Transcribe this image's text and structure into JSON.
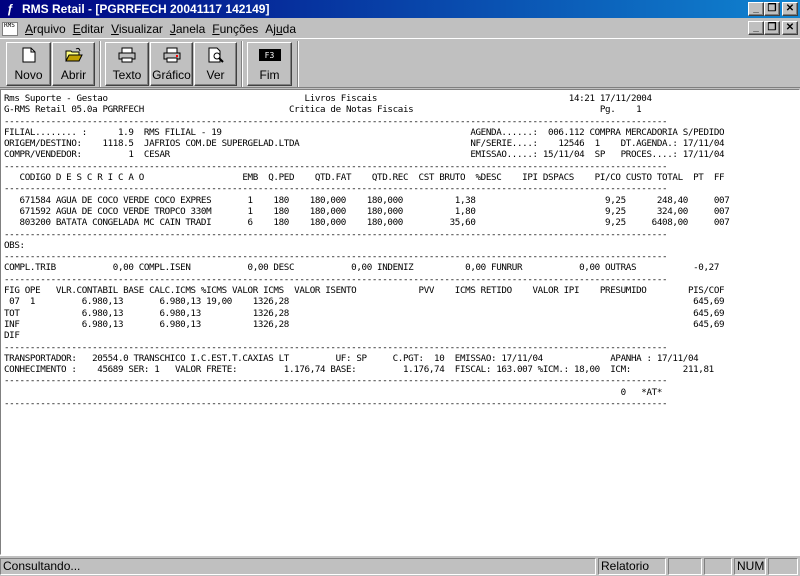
{
  "window": {
    "app_icon": "ƒ",
    "title": "RMS Retail - [PGRRFECH 20041117 142149]"
  },
  "menu": {
    "mdi_icon_text": "RMS",
    "items": [
      {
        "label": "Arquivo",
        "accel": "A",
        "rest": "rquivo"
      },
      {
        "label": "Editar",
        "accel": "E",
        "rest": "ditar"
      },
      {
        "label": "Visualizar",
        "accel": "V",
        "rest": "isualizar"
      },
      {
        "label": "Janela",
        "accel": "J",
        "rest": "anela"
      },
      {
        "label": "Funções",
        "accel": "F",
        "rest": "unções"
      },
      {
        "label": "Ajuda",
        "accel": "u",
        "pre": "Aj",
        "rest": "da"
      }
    ]
  },
  "toolbar": {
    "novo": "Novo",
    "abrir": "Abrir",
    "texto": "Texto",
    "grafico": "Gráfico",
    "ver": "Ver",
    "fim": "Fim",
    "f3_key": "F3"
  },
  "report": {
    "lines": [
      "Rms Suporte - Gestao                                      Livros Fiscais                                     14:21 17/11/2004",
      "G-RMS Retail 05.0a PGRRFECH                            Critica de Notas Fiscais                                    Pg.    1",
      "--------------------------------------------------------------------------------------------------------------------------------",
      "FILIAL........ :      1.9  RMS FILIAL - 19                                                AGENDA......:  006.112 COMPRA MERCADORIA S/PEDIDO",
      "ORIGEM/DESTINO:    1118.5  JAFRIOS COM.DE SUPERGELAD.LTDA                                 NF/SERIE....:    12546  1    DT.AGENDA.: 17/11/04",
      "COMPR/VENDEDOR:         1  CESAR                                                          EMISSAO.....: 15/11/04  SP   PROCES....: 17/11/04",
      "--------------------------------------------------------------------------------------------------------------------------------",
      "   CODIGO D E S C R I C A O                   EMB  Q.PED    QTD.FAT    QTD.REC  CST BRUTO  %DESC    IPI DSPACS    PI/CO CUSTO TOTAL  PT  FF",
      "--------------------------------------------------------------------------------------------------------------------------------",
      "   671584 AGUA DE COCO VERDE COCO EXPRES       1    180    180,000    180,000          1,38                         9,25      248,40     007",
      "   671592 AGUA DE COCO VERDE TROPCO 330M       1    180    180,000    180,000          1,80                         9,25      324,00     007",
      "   803200 BATATA CONGELADA MC CAIN TRADI       6    180    180,000    180,000         35,60                         9,25     6408,00     007",
      "--------------------------------------------------------------------------------------------------------------------------------",
      "OBS:",
      "--------------------------------------------------------------------------------------------------------------------------------",
      "COMPL.TRIB           0,00 COMPL.ISEN           0,00 DESC           0,00 INDENIZ          0,00 FUNRUR           0,00 OUTRAS           -0,27",
      "--------------------------------------------------------------------------------------------------------------------------------",
      "FIG OPE   VLR.CONTABIL BASE CALC.ICMS %ICMS VALOR ICMS  VALOR ISENTO            PVV    ICMS RETIDO    VALOR IPI    PRESUMIDO        PIS/COF",
      " 07  1         6.980,13       6.980,13 19,00    1326,28                                                                              645,69",
      "TOT            6.980,13       6.980,13          1326,28                                                                              645,69",
      "INF            6.980,13       6.980,13          1326,28                                                                              645,69",
      "DIF",
      "--------------------------------------------------------------------------------------------------------------------------------",
      "TRANSPORTADOR:   20554.0 TRANSCHICO I.C.EST.T.CAXIAS LT         UF: SP     C.PGT:  10  EMISSAO: 17/11/04             APANHA : 17/11/04",
      "CONHECIMENTO :    45689 SER: 1   VALOR FRETE:         1.176,74 BASE:         1.176,74  FISCAL: 163.007 %ICM.: 18,00  ICM:          211,81",
      "--------------------------------------------------------------------------------------------------------------------------------",
      "                                                                                                                       0   *AT*",
      "--------------------------------------------------------------------------------------------------------------------------------"
    ]
  },
  "status": {
    "message": "Consultando...",
    "mode": "Relatorio",
    "num": "NUM"
  }
}
